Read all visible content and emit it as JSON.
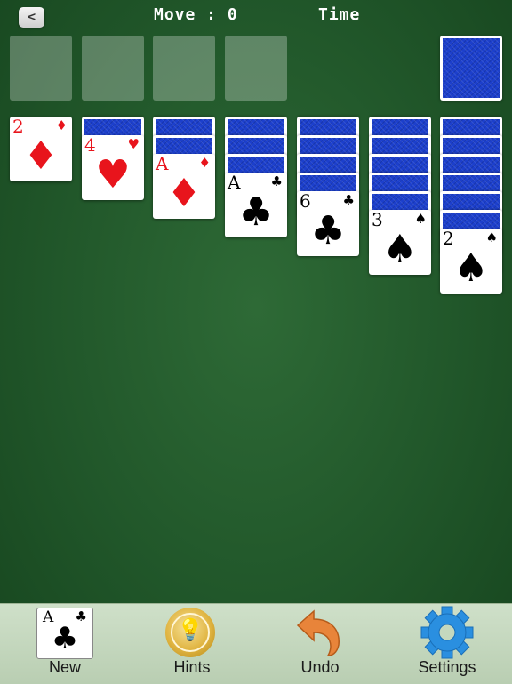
{
  "header": {
    "back_label": "<",
    "move_text": "Move : 0",
    "time_text": "Time"
  },
  "tableau": {
    "columns": [
      {
        "face_down": 0,
        "face_up": [
          {
            "rank": "2",
            "suit": "♦",
            "color": "red"
          }
        ]
      },
      {
        "face_down": 1,
        "face_up": [
          {
            "rank": "4",
            "suit": "♥",
            "color": "red"
          }
        ]
      },
      {
        "face_down": 2,
        "face_up": [
          {
            "rank": "A",
            "suit": "♦",
            "color": "red"
          }
        ]
      },
      {
        "face_down": 3,
        "face_up": [
          {
            "rank": "A",
            "suit": "♣",
            "color": "black"
          }
        ]
      },
      {
        "face_down": 4,
        "face_up": [
          {
            "rank": "6",
            "suit": "♣",
            "color": "black"
          }
        ]
      },
      {
        "face_down": 5,
        "face_up": [
          {
            "rank": "3",
            "suit": "♠",
            "color": "black"
          }
        ]
      },
      {
        "face_down": 6,
        "face_up": [
          {
            "rank": "2",
            "suit": "♠",
            "color": "black"
          }
        ]
      }
    ]
  },
  "toolbar": {
    "new_label": "New",
    "new_icon_rank": "A",
    "new_icon_suit": "♣",
    "hints_label": "Hints",
    "hints_glyph": "💡",
    "undo_label": "Undo",
    "settings_label": "Settings"
  },
  "colors": {
    "felt": "#21572a",
    "card_back": "#1c3fcc",
    "red_suit": "#e8141c",
    "toolbar": "#c4d8be",
    "undo_arrow": "#e8843a",
    "gear": "#2a8fe0"
  }
}
